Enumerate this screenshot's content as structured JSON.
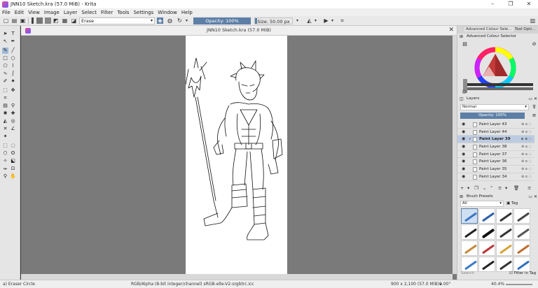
{
  "window": {
    "title": "JNN10 Sketch.kra (57.0 MiB) - Krita",
    "controls": [
      "–",
      "❐",
      "✕"
    ]
  },
  "menu": [
    "File",
    "Edit",
    "View",
    "Image",
    "Layer",
    "Select",
    "Filter",
    "Tools",
    "Settings",
    "Window",
    "Help"
  ],
  "toolbar": {
    "blend_mode": "Erase",
    "opacity_label": "Opacity: 100%",
    "opacity_fraction": 1.0,
    "size_label": "Size: 50.00 px",
    "size_fraction": 0.05
  },
  "document": {
    "tab_title": "JNN10 Sketch.kra (57.0 MiB)"
  },
  "dock": {
    "tabs": [
      "Advanced Colour Sele...",
      "Tool Opti..."
    ],
    "color_panel_title": "Advanced Colour Selector",
    "layers_title": "Layers",
    "blend_mode": "Normal",
    "opacity_label": "Opacity: 100%",
    "layers": [
      {
        "name": "Paint Layer 43",
        "selected": false
      },
      {
        "name": "Paint Layer 44",
        "selected": false
      },
      {
        "name": "Paint Layer 39",
        "selected": true
      },
      {
        "name": "Paint Layer 38",
        "selected": false
      },
      {
        "name": "Paint Layer 37",
        "selected": false
      },
      {
        "name": "Paint Layer 36",
        "selected": false
      },
      {
        "name": "Paint Layer 35",
        "selected": false
      },
      {
        "name": "Paint Layer 34",
        "selected": false
      }
    ],
    "presets_title": "Brush Presets",
    "presets_filter": "All",
    "presets_tag": "Tag",
    "search_placeholder": "Search",
    "filter_in_tag": "Filter in Tag"
  },
  "status": {
    "brush": "a) Eraser Circle",
    "color_space": "RGB/Alpha (8-bit integer/channel)  sRGB-elle-V2-srgbtrc.icc",
    "image_size": "900 x 2,100 (57.0 MiB)",
    "rotation": "0.00°",
    "zoom": "40.4%"
  },
  "colors": {
    "accent": "#5d7fa6",
    "selection": "#bccbe1",
    "canvas_bg": "#7a7a7a"
  }
}
